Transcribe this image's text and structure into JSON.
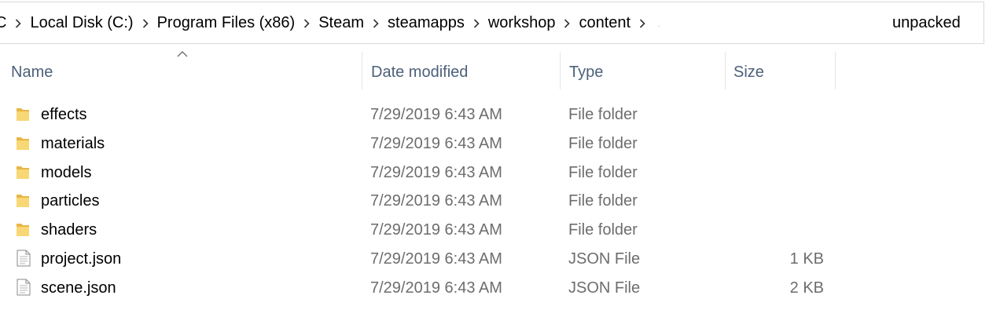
{
  "address_bar": {
    "crumbs": [
      "C",
      "Local Disk (C:)",
      "Program Files (x86)",
      "Steam",
      "steamapps",
      "workshop",
      "content"
    ],
    "current_folder": "unpacked"
  },
  "columns": {
    "name": "Name",
    "date_modified": "Date modified",
    "type": "Type",
    "size": "Size"
  },
  "files": [
    {
      "name": "effects",
      "date": "7/29/2019 6:43 AM",
      "type": "File folder",
      "size": "",
      "icon": "folder-icon"
    },
    {
      "name": "materials",
      "date": "7/29/2019 6:43 AM",
      "type": "File folder",
      "size": "",
      "icon": "folder-icon"
    },
    {
      "name": "models",
      "date": "7/29/2019 6:43 AM",
      "type": "File folder",
      "size": "",
      "icon": "folder-icon"
    },
    {
      "name": "particles",
      "date": "7/29/2019 6:43 AM",
      "type": "File folder",
      "size": "",
      "icon": "folder-icon"
    },
    {
      "name": "shaders",
      "date": "7/29/2019 6:43 AM",
      "type": "File folder",
      "size": "",
      "icon": "folder-icon"
    },
    {
      "name": "project.json",
      "date": "7/29/2019 6:43 AM",
      "type": "JSON File",
      "size": "1 KB",
      "icon": "file-icon"
    },
    {
      "name": "scene.json",
      "date": "7/29/2019 6:43 AM",
      "type": "JSON File",
      "size": "2 KB",
      "icon": "file-icon"
    }
  ],
  "colors": {
    "header_text": "#4c607a",
    "meta_text": "#6d6d6d",
    "folder_yellow": "#f8d775"
  }
}
